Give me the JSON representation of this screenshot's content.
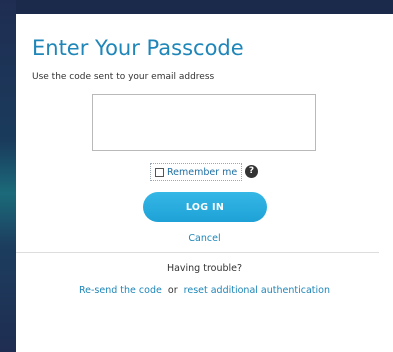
{
  "form": {
    "title": "Enter Your Passcode",
    "instruction": "Use the code sent to your email address",
    "passcode_value": "",
    "remember_label": "Remember me",
    "help_glyph": "?",
    "login_label": "LOG IN",
    "cancel_label": "Cancel",
    "trouble_heading": "Having trouble?",
    "resend_label": "Re-send the code",
    "or_text": "or",
    "reset_label": "reset additional authentication"
  },
  "colors": {
    "accent": "#1e86b8",
    "button": "#1ea1d6",
    "background": "#1b2a4a"
  }
}
